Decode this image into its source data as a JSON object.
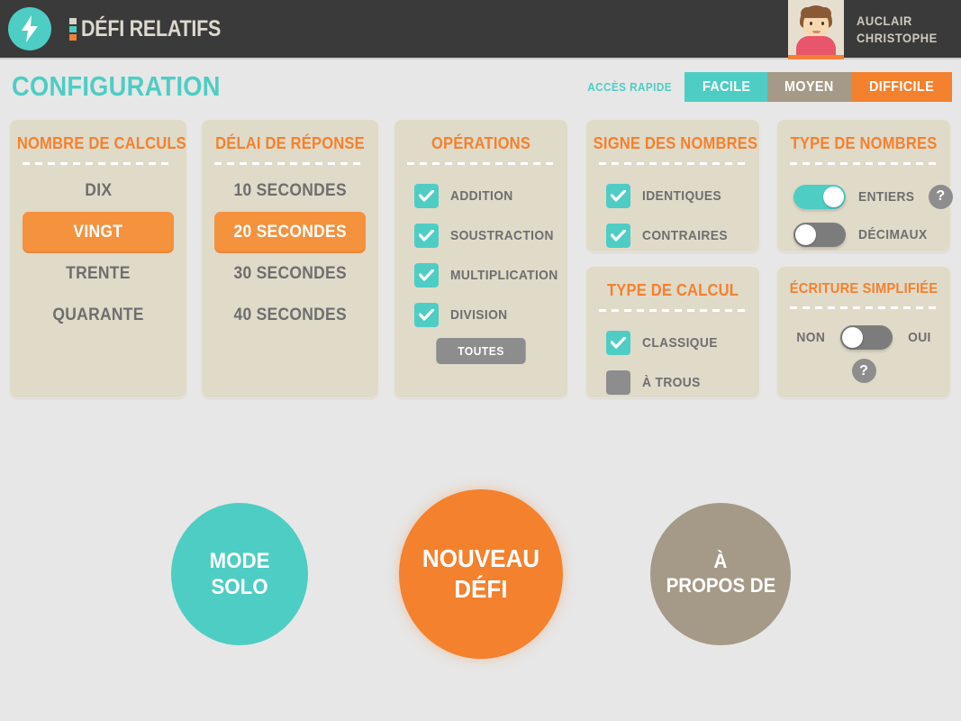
{
  "header": {
    "logo_icon": "lightning-bolt-icon",
    "app_title": "DÉFI RELATIFS",
    "user": {
      "avatar_icon": "user-avatar",
      "last_name": "AUCLAIR",
      "first_name": "CHRISTOPHE"
    }
  },
  "page": {
    "title": "CONFIGURATION",
    "quick_access": {
      "label": "ACCÈS RAPIDE",
      "options": [
        {
          "label": "FACILE",
          "color": "#4ecdc4",
          "selected": false
        },
        {
          "label": "MOYEN",
          "color": "#a59a87",
          "selected": false
        },
        {
          "label": "DIFFICILE",
          "color": "#f4812d",
          "selected": true
        }
      ]
    }
  },
  "panels": {
    "nombre_de_calculs": {
      "title": "NOMBRE DE CALCULS",
      "options": [
        {
          "label": "DIX",
          "selected": false
        },
        {
          "label": "VINGT",
          "selected": true
        },
        {
          "label": "TRENTE",
          "selected": false
        },
        {
          "label": "QUARANTE",
          "selected": false
        }
      ]
    },
    "delai_de_reponse": {
      "title": "DÉLAI DE RÉPONSE",
      "options": [
        {
          "label": "10 SECONDES",
          "selected": false
        },
        {
          "label": "20 SECONDES",
          "selected": true
        },
        {
          "label": "30 SECONDES",
          "selected": false
        },
        {
          "label": "40 SECONDES",
          "selected": false
        }
      ]
    },
    "operations": {
      "title": "OPÉRATIONS",
      "checkboxes": [
        {
          "label": "ADDITION",
          "checked": true
        },
        {
          "label": "SOUSTRACTION",
          "checked": true
        },
        {
          "label": "MULTIPLICATION",
          "checked": true
        },
        {
          "label": "DIVISION",
          "checked": true
        }
      ],
      "all_button": "TOUTES"
    },
    "signe_des_nombres": {
      "title": "SIGNE DES NOMBRES",
      "checkboxes": [
        {
          "label": "IDENTIQUES",
          "checked": true
        },
        {
          "label": "CONTRAIRES",
          "checked": true
        }
      ]
    },
    "type_de_calcul": {
      "title": "TYPE DE CALCUL",
      "checkboxes": [
        {
          "label": "CLASSIQUE",
          "checked": true
        },
        {
          "label": "À TROUS",
          "checked": false
        }
      ]
    },
    "type_de_nombres": {
      "title": "TYPE DE NOMBRES",
      "toggles": [
        {
          "label": "ENTIERS",
          "on": true,
          "has_help": true
        },
        {
          "label": "DÉCIMAUX",
          "on": false,
          "has_help": false
        }
      ],
      "help_label": "?"
    },
    "ecriture_simplifiee": {
      "title": "ÉCRITURE SIMPLIFIÉE",
      "off_label": "NON",
      "on_label": "OUI",
      "value_on": false,
      "help_label": "?"
    }
  },
  "actions": [
    {
      "line1": "MODE",
      "line2": "SOLO",
      "color": "#4ecdc4"
    },
    {
      "line1": "NOUVEAU",
      "line2": "DÉFI",
      "color": "#f4812d"
    },
    {
      "line1": "À",
      "line2": "PROPOS DE",
      "color": "#a59a87"
    }
  ]
}
